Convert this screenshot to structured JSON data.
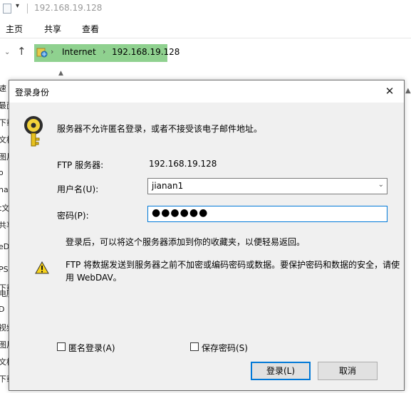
{
  "explorer": {
    "title": "192.168.19.128",
    "quick_access": "▾",
    "ribbon_tabs": [
      "主页",
      "共享",
      "查看"
    ],
    "address": {
      "segments": [
        "Internet",
        "192.168.19.128"
      ],
      "separator": "›"
    },
    "nav_up": "↑",
    "nav_down": "⌄",
    "scroll_up": "▲",
    "left_pane_fragments": [
      "速",
      "最面",
      "下载",
      "文档",
      "图片",
      "o",
      "ha",
      "t文",
      "共享",
      "eD",
      "PS",
      "下载",
      "电脑",
      "D",
      "视频",
      "图片",
      "文档",
      "下载"
    ]
  },
  "dialog": {
    "title": "登录身份",
    "close": "✕",
    "message": "服务器不允许匿名登录，或者不接受该电子邮件地址。",
    "ftp_server_label": "FTP 服务器:",
    "ftp_server_value": "192.168.19.128",
    "username_label": "用户名(U):",
    "username_value": "jianan1",
    "password_label": "密码(P):",
    "password_value": "●●●●●●",
    "hint": "登录后，可以将这个服务器添加到你的收藏夹，以便轻易返回。",
    "warning": "FTP 将数据发送到服务器之前不加密或编码密码或数据。要保护密码和数据的安全，请使用 WebDAV。",
    "anonymous_label": "匿名登录(A)",
    "save_password_label": "保存密码(S)",
    "login_button": "登录(L)",
    "cancel_button": "取消"
  },
  "colors": {
    "address_highlight": "#8fd18f",
    "focus_border": "#0078d7",
    "dialog_bg": "#f0f0f0"
  }
}
